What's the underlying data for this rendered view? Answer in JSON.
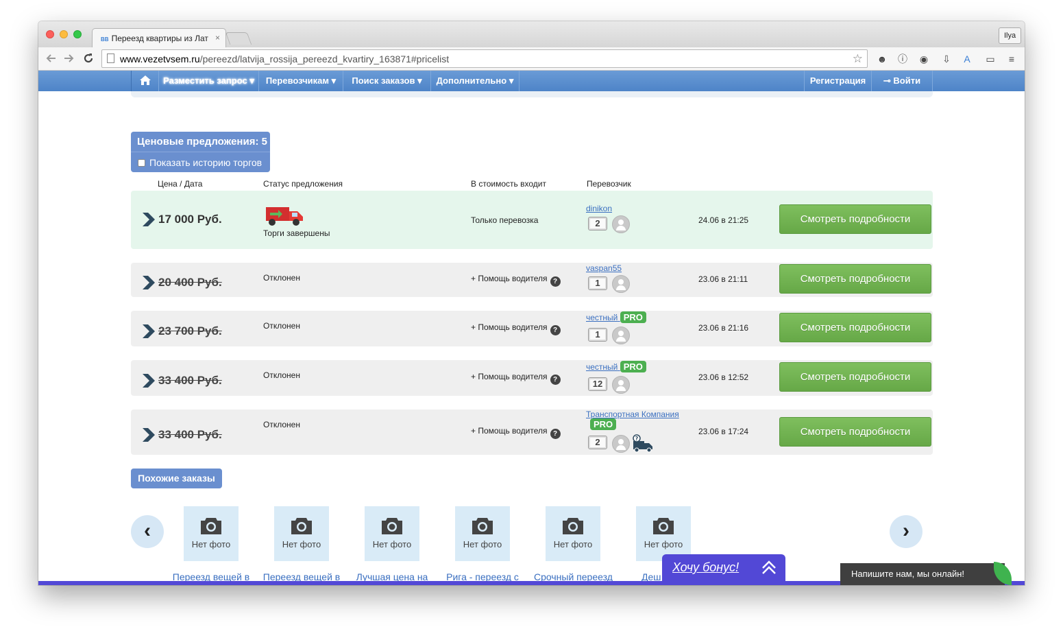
{
  "browser": {
    "tab_title": "Переезд квартиры из Лат",
    "tab_close": "×",
    "tab_favicon": "BB",
    "user_name": "Ilya",
    "url_domain": "www.vezetvsem.ru",
    "url_path": "/pereezd/latvija_rossija_pereezd_kvartiry_163871#pricelist"
  },
  "site_nav": {
    "post_request": "Разместить запрос ▾",
    "carriers": "Перевозчикам ▾",
    "search_orders": "Поиск заказов ▾",
    "more": "Дополнительно ▾",
    "register": "Регистрация",
    "login": "⊸ Войти"
  },
  "offers": {
    "header": "Ценовые предложения: 5",
    "history_label": "Показать историю торгов",
    "columns": {
      "price_date": "Цена / Дата",
      "status": "Статус предложения",
      "included": "В стоимость входит",
      "carrier": "Перевозчик"
    },
    "details_label": "Смотреть подробности",
    "rows": [
      {
        "price": "17 000 Руб.",
        "status": "Торги завершены",
        "included": "Только перевозка",
        "carrier": "dinikon",
        "rating": "2",
        "date": "24.06 в 21:25",
        "pro": ""
      },
      {
        "price": "20 400 Руб.",
        "status": "Отклонен",
        "included": "+ Помощь водителя",
        "carrier": "vaspan55",
        "rating": "1",
        "date": "23.06 в 21:11",
        "pro": ""
      },
      {
        "price": "23 700 Руб.",
        "status": "Отклонен",
        "included": "+ Помощь водителя",
        "carrier": "честный",
        "rating": "1",
        "date": "23.06 в 21:16",
        "pro": "PRO"
      },
      {
        "price": "33 400 Руб.",
        "status": "Отклонен",
        "included": "+ Помощь водителя",
        "carrier": "честный",
        "rating": "12",
        "date": "23.06 в 12:52",
        "pro": "PRO"
      },
      {
        "price": "33 400 Руб.",
        "status": "Отклонен",
        "included": "+ Помощь водителя",
        "carrier": "Транспортная Компания",
        "rating": "2",
        "date": "23.06 в 17:24",
        "pro": "PRO"
      }
    ],
    "help_mark": "?"
  },
  "similar": {
    "header": "Похожие заказы",
    "prev": "‹",
    "next": "›",
    "no_photo": "Нет фото",
    "titles": [
      "Переезд вещей в",
      "Переезд вещей в",
      "Лучшая цена на",
      "Рига - переезд с",
      "Срочный переезд",
      "Деш"
    ]
  },
  "widgets": {
    "bonus": "Хочу бонус!",
    "chat": "Напишите нам, мы онлайн!"
  },
  "colors": {
    "nav_blue": "#4e84c8",
    "button_green": "#6aab4a",
    "pro_green": "#4caf50",
    "winner_row": "#e5f6ec",
    "bonus_purple": "#5248d6"
  }
}
